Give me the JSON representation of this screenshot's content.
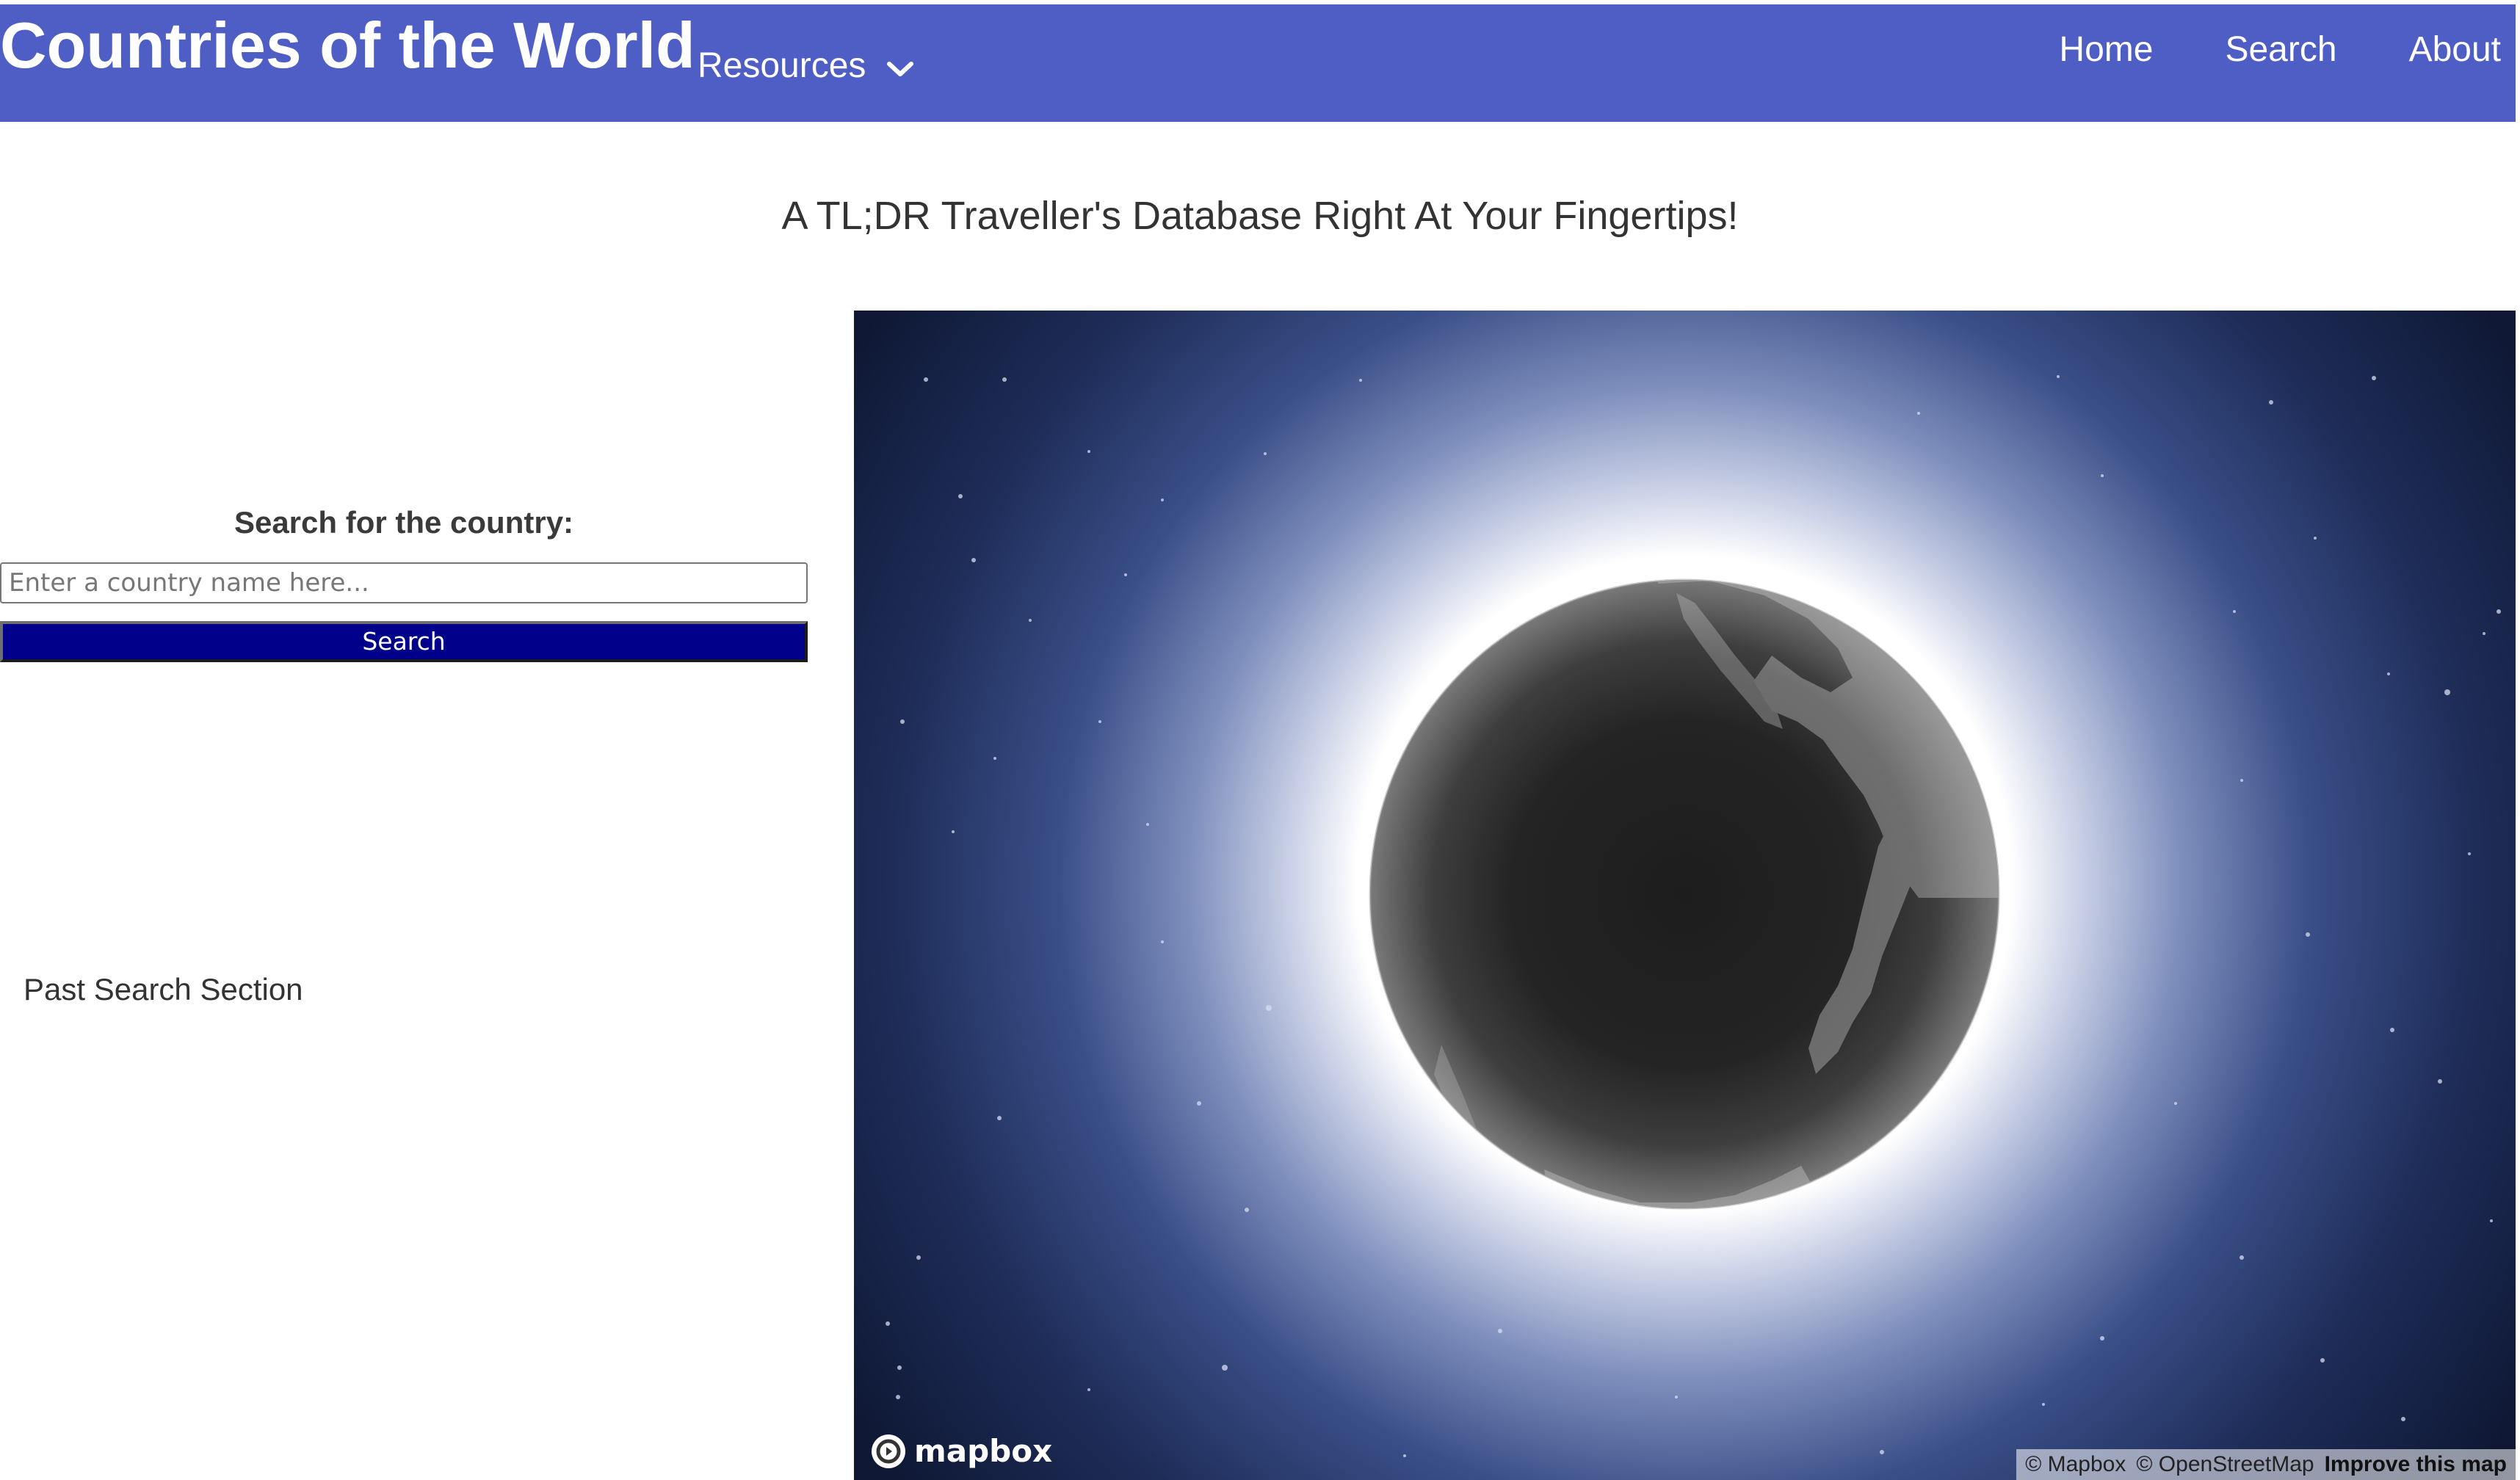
{
  "header": {
    "brand": "Countries of the World",
    "resources_label": "Resources",
    "nav": [
      "Home",
      "Search",
      "About"
    ],
    "background_color": "#4f5ec4"
  },
  "tagline": "A TL;DR Traveller's Database Right At Your Fingertips!",
  "search": {
    "label": "Search for the country:",
    "placeholder": "Enter a country name here...",
    "value": "",
    "button_label": "Search",
    "button_color": "#00008b"
  },
  "past_search": {
    "title": "Past Search Section"
  },
  "map": {
    "projection": "globe",
    "logo_text": "mapbox",
    "attribution": {
      "mapbox": "© Mapbox",
      "osm": "© OpenStreetMap",
      "improve": "Improve this map"
    }
  }
}
